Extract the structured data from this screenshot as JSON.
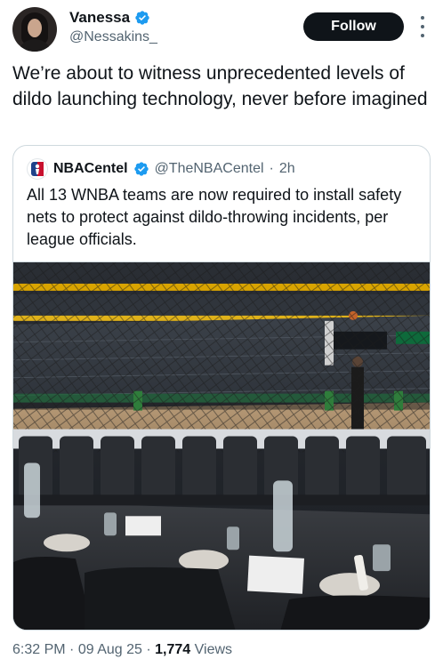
{
  "author": {
    "display_name": "Vanessa",
    "handle": "@Nessakins_"
  },
  "actions": {
    "follow_label": "Follow"
  },
  "tweet": {
    "text": "We’re about to witness unprecedented levels of dildo launching technology, never before imagined"
  },
  "quoted_tweet": {
    "display_name": "NBACentel",
    "handle": "@TheNBACentel",
    "separator": "·",
    "time": "2h",
    "text": "All 13 WNBA teams are now required to install safety nets to protect against dildo-throwing incidents, per league officials.",
    "image": {
      "icon": "arena-photo"
    }
  },
  "meta": {
    "time": "6:32 PM",
    "sep1": "·",
    "date": "09 Aug 25",
    "sep2": "·",
    "views_count": "1,774",
    "views_label": "Views"
  },
  "colors": {
    "verified": "#1d9bf0",
    "follow_bg": "#0f1419",
    "secondary_text": "#536471",
    "border": "#cfd9de"
  }
}
